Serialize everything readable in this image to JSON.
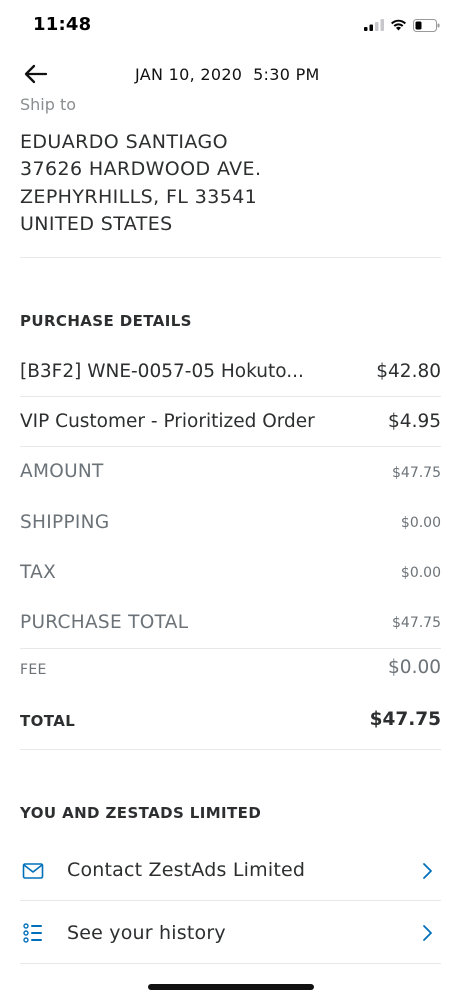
{
  "status_bar": {
    "time": "11:48"
  },
  "header": {
    "date": "JAN 10, 2020",
    "time": "5:30 PM"
  },
  "ship_to": {
    "label": "Ship to",
    "name": "EDUARDO SANTIAGO",
    "street": "37626 HARDWOOD AVE.",
    "city_line": "ZEPHYRHILLS, FL 33541",
    "country": "UNITED STATES"
  },
  "purchase_details": {
    "title": "PURCHASE DETAILS",
    "items": [
      {
        "name": "[B3F2] WNE-0057-05 Hokuto...",
        "price": "$42.80"
      },
      {
        "name": "VIP Customer - Prioritized Order",
        "price": "$4.95"
      }
    ],
    "amount": {
      "label": "AMOUNT",
      "value": "$47.75"
    },
    "shipping": {
      "label": "SHIPPING",
      "value": "$0.00"
    },
    "tax": {
      "label": "TAX",
      "value": "$0.00"
    },
    "purchase_total": {
      "label": "PURCHASE TOTAL",
      "value": "$47.75"
    },
    "fee": {
      "label": "FEE",
      "value": "$0.00"
    },
    "total": {
      "label": "TOTAL",
      "value": "$47.75"
    }
  },
  "seller_section": {
    "title": "YOU AND ZESTADS LIMITED",
    "links": [
      {
        "label": "Contact ZestAds Limited",
        "icon": "mail-icon"
      },
      {
        "label": "See your history",
        "icon": "list-icon"
      }
    ]
  },
  "colors": {
    "link_icon": "#0070ba",
    "divider": "#e6e8ea",
    "muted": "#6c7378"
  }
}
